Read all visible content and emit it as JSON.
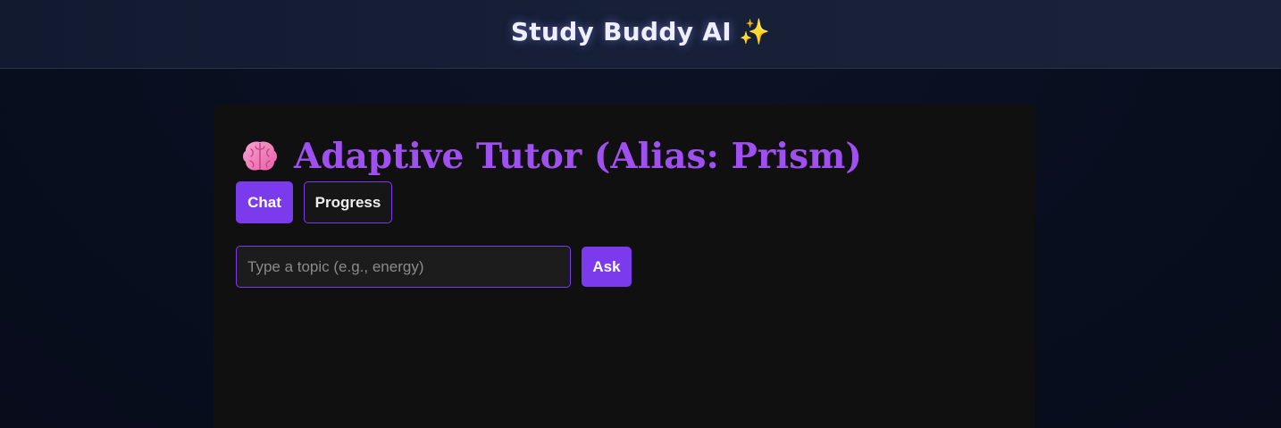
{
  "header": {
    "title": "Study Buddy AI",
    "sparkle_icon": "✨"
  },
  "tutor": {
    "heading": "Adaptive Tutor (Alias: Prism)",
    "brain_icon": "brain-icon"
  },
  "tabs": [
    {
      "label": "Chat",
      "active": true
    },
    {
      "label": "Progress",
      "active": false
    }
  ],
  "ask": {
    "placeholder": "Type a topic (e.g., energy)",
    "value": "",
    "button_label": "Ask"
  },
  "colors": {
    "accent": "#7c3aed",
    "heading": "#a04ff0",
    "panel_bg": "#101010",
    "page_bg": "#090e1f"
  }
}
